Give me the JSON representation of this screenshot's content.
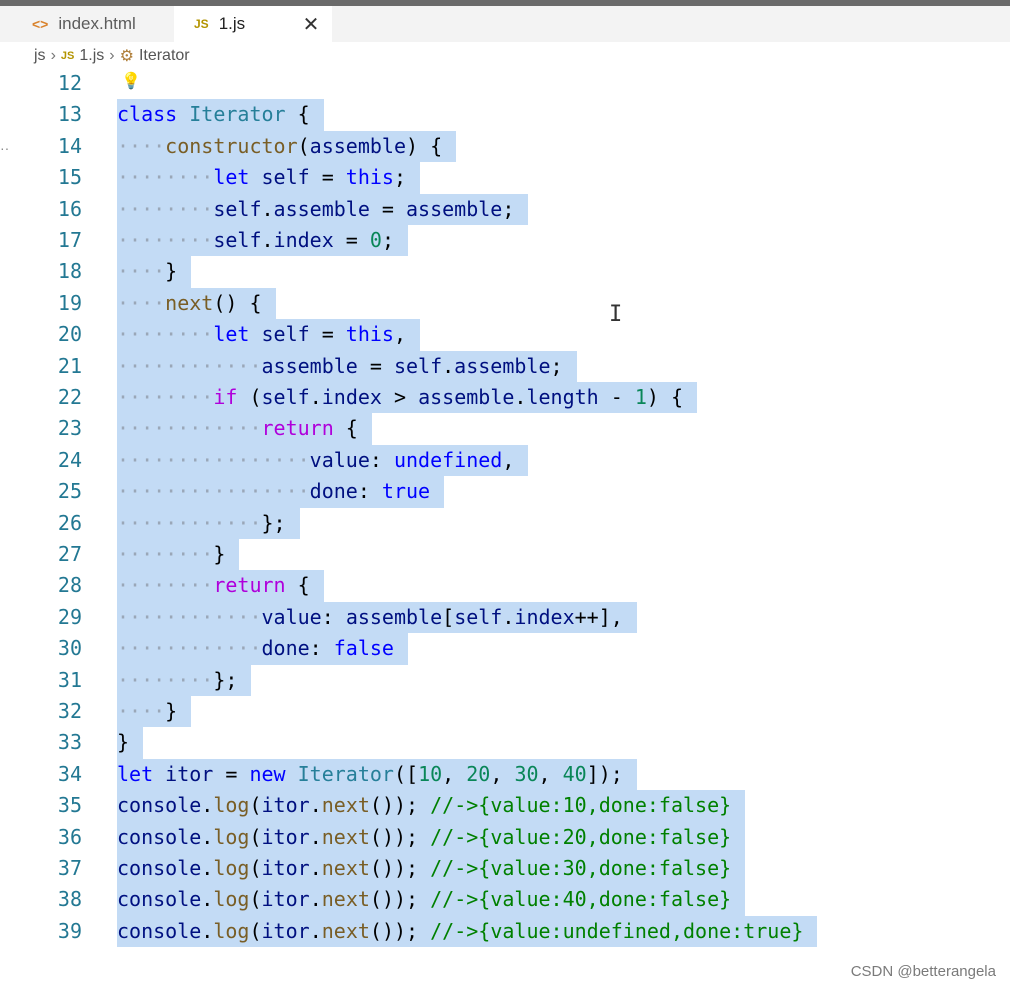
{
  "tabs": [
    {
      "icon": "html-file-icon",
      "label": "index.html",
      "active": false
    },
    {
      "icon": "js-file-icon",
      "label": "1.js",
      "active": true,
      "close": "✕"
    }
  ],
  "breadcrumb": {
    "folder": "js",
    "file_icon_text": "JS",
    "file": "1.js",
    "symbol": "Iterator"
  },
  "editor": {
    "lines": [
      {
        "num": "12",
        "code": "",
        "selected": false
      },
      {
        "num": "13",
        "code": "class Iterator {"
      },
      {
        "num": "14",
        "code": "    constructor(assemble) {"
      },
      {
        "num": "15",
        "code": "        let self = this;"
      },
      {
        "num": "16",
        "code": "        self.assemble = assemble;"
      },
      {
        "num": "17",
        "code": "        self.index = 0;"
      },
      {
        "num": "18",
        "code": "    }"
      },
      {
        "num": "19",
        "code": "    next() {"
      },
      {
        "num": "20",
        "code": "        let self = this,"
      },
      {
        "num": "21",
        "code": "            assemble = self.assemble;"
      },
      {
        "num": "22",
        "code": "        if (self.index > assemble.length - 1) {"
      },
      {
        "num": "23",
        "code": "            return {"
      },
      {
        "num": "24",
        "code": "                value: undefined,"
      },
      {
        "num": "25",
        "code": "                done: true"
      },
      {
        "num": "26",
        "code": "            };"
      },
      {
        "num": "27",
        "code": "        }"
      },
      {
        "num": "28",
        "code": "        return {"
      },
      {
        "num": "29",
        "code": "            value: assemble[self.index++],"
      },
      {
        "num": "30",
        "code": "            done: false"
      },
      {
        "num": "31",
        "code": "        };"
      },
      {
        "num": "32",
        "code": "    }"
      },
      {
        "num": "33",
        "code": "}"
      },
      {
        "num": "34",
        "code": "let itor = new Iterator([10, 20, 30, 40]);"
      },
      {
        "num": "35",
        "code": "console.log(itor.next()); //->{value:10,done:false}"
      },
      {
        "num": "36",
        "code": "console.log(itor.next()); //->{value:20,done:false}"
      },
      {
        "num": "37",
        "code": "console.log(itor.next()); //->{value:30,done:false}"
      },
      {
        "num": "38",
        "code": "console.log(itor.next()); //->{value:40,done:false}"
      },
      {
        "num": "39",
        "code": "console.log(itor.next()); //->{value:undefined,done:true}"
      }
    ]
  },
  "watermark": "CSDN @betterangela",
  "colors": {
    "selection": "#c3dbf5",
    "line_number": "#237893",
    "keyword": "#0000ff",
    "control": "#af00db",
    "comment": "#008000",
    "number": "#098658",
    "class": "#267f99"
  }
}
